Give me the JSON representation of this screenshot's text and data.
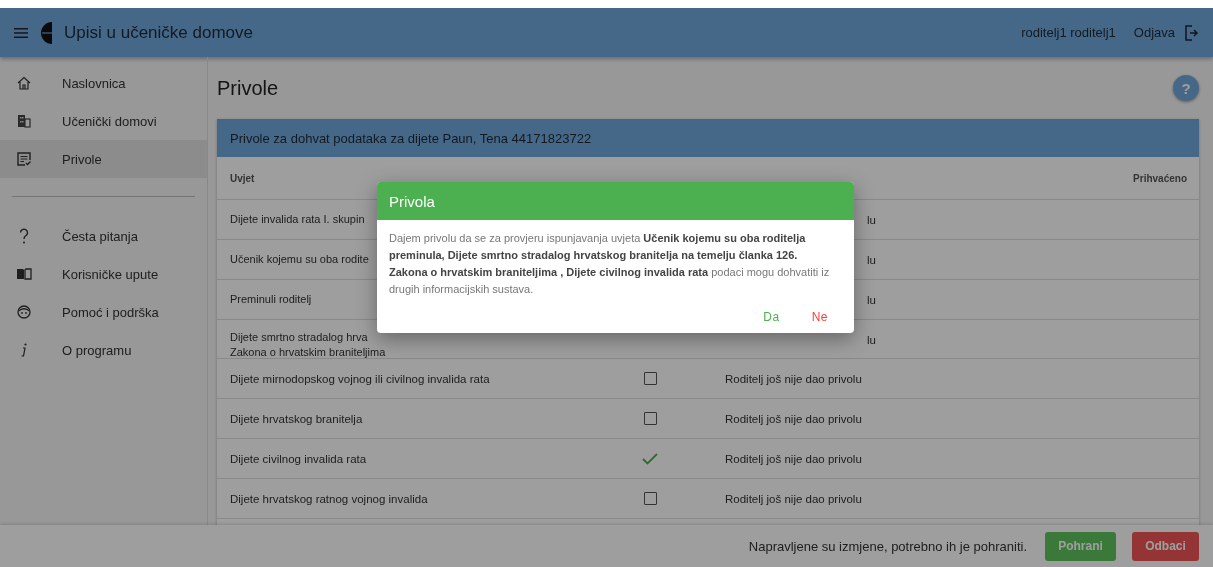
{
  "app_bar": {
    "title": "Upisi u učeničke domove",
    "user": "roditelj1 roditelj1",
    "logout": "Odjava"
  },
  "sidebar": {
    "items": [
      {
        "label": "Naslovnica",
        "selected": false
      },
      {
        "label": "Učenički domovi",
        "selected": false
      },
      {
        "label": "Privole",
        "selected": true
      }
    ],
    "help_items": [
      {
        "label": "Česta pitanja"
      },
      {
        "label": "Korisničke upute"
      },
      {
        "label": "Pomoć i podrška"
      },
      {
        "label": "O programu"
      }
    ]
  },
  "page": {
    "title": "Privole",
    "help_button": "?"
  },
  "card": {
    "title": "Privole za dohvat podataka za dijete Paun, Tena 44171823722",
    "table": {
      "columns": [
        "Uvjet",
        "Prihvaćeno"
      ],
      "covered_rows": [
        {
          "condition": "Dijete invalida rata I. skupin",
          "status": "lu"
        },
        {
          "condition": "Učenik kojemu su oba rodite",
          "status": "lu"
        },
        {
          "condition": "Preminuli roditelj",
          "status": "lu"
        },
        {
          "condition": "Dijete smrtno stradalog hrva",
          "condition_line_2": "Zakona o hrvatskim braniteljima",
          "status": "lu"
        }
      ],
      "rows": [
        {
          "condition": "Dijete mirnodopskog vojnog ili civilnog invalida rata",
          "checked": false,
          "status": "Roditelj još nije dao privolu"
        },
        {
          "condition": "Dijete hrvatskog branitelja",
          "checked": false,
          "status": "Roditelj još nije dao privolu"
        },
        {
          "condition": "Dijete civilnog invalida rata",
          "checked": true,
          "status": "Roditelj još nije dao privolu"
        },
        {
          "condition": "Dijete hrvatskog ratnog vojnog invalida",
          "checked": false,
          "status": "Roditelj još nije dao privolu"
        }
      ]
    }
  },
  "footer": {
    "message": "Napravljene su izmjene, potrebno ih je pohraniti.",
    "buttons": [
      {
        "label": "Pohrani",
        "kind": "save"
      },
      {
        "label": "Odbaci",
        "kind": "discard"
      }
    ]
  },
  "dialog": {
    "title": "Privola",
    "text": "Dajem privolu da se za provjeru ispunjavanja uvjeta **Učenik kojemu su oba roditelja preminula, Dijete smrtno stradalog hrvatskog branitelja na temelju članka 126. Zakona o hrvatskim braniteljima , Dijete civilnog invalida rata** podaci mogu dohvatiti iz drugih informacijskih sustava.",
    "accept": "Da",
    "decline": "Ne"
  }
}
